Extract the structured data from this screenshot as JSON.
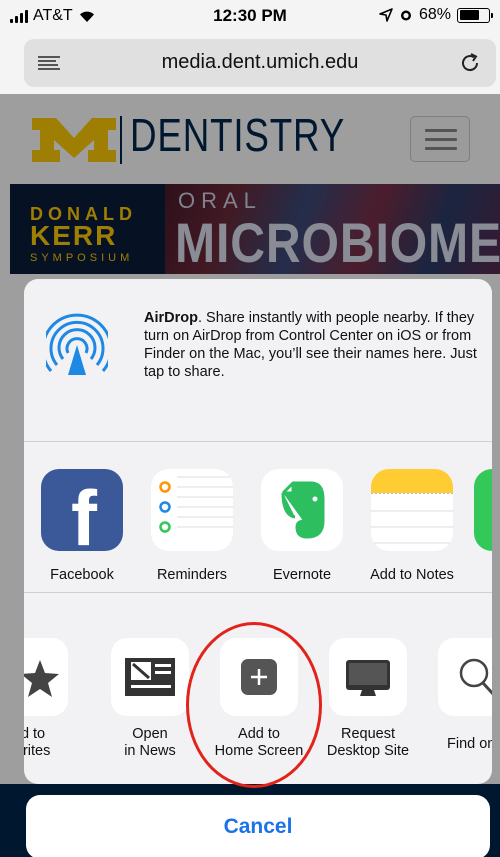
{
  "status_bar": {
    "carrier": "AT&T",
    "time": "12:30 PM",
    "battery": "68%",
    "battery_level": 0.68
  },
  "url_bar": {
    "url": "media.dent.umich.edu"
  },
  "website": {
    "logo_letter": "M",
    "title": "DENTISTRY",
    "banner": {
      "line1": "DONALD",
      "line2": "KERR",
      "line3": "SYMPOSIUM",
      "oral": "ORAL",
      "microbiome": "MICROBIOME"
    }
  },
  "share_sheet": {
    "airdrop": {
      "title": "AirDrop",
      "description": ". Share instantly with people nearby. If they turn on AirDrop from Control Center on iOS or from Finder on the Mac, you’ll see their names here. Just tap to share."
    },
    "apps": [
      {
        "label": "Facebook",
        "icon": "facebook-icon"
      },
      {
        "label": "Reminders",
        "icon": "reminders-icon"
      },
      {
        "label": "Evernote",
        "icon": "evernote-icon"
      },
      {
        "label": "Add to Notes",
        "icon": "notes-icon"
      }
    ],
    "actions": [
      {
        "line1": "dd to",
        "line2": "vorites",
        "icon": "star-icon"
      },
      {
        "line1": "Open",
        "line2": "in News",
        "icon": "news-icon"
      },
      {
        "line1": "Add to",
        "line2": "Home Screen",
        "icon": "add-square-icon"
      },
      {
        "line1": "Request",
        "line2": "Desktop Site",
        "icon": "monitor-icon"
      },
      {
        "line1": "Find on P",
        "line2": "",
        "icon": "magnifier-icon"
      }
    ],
    "cancel_label": "Cancel"
  },
  "colors": {
    "accent": "#1a73e8",
    "highlight": "#e2231a",
    "umich_blue": "#00274c",
    "umich_maize": "#ffcb05"
  }
}
